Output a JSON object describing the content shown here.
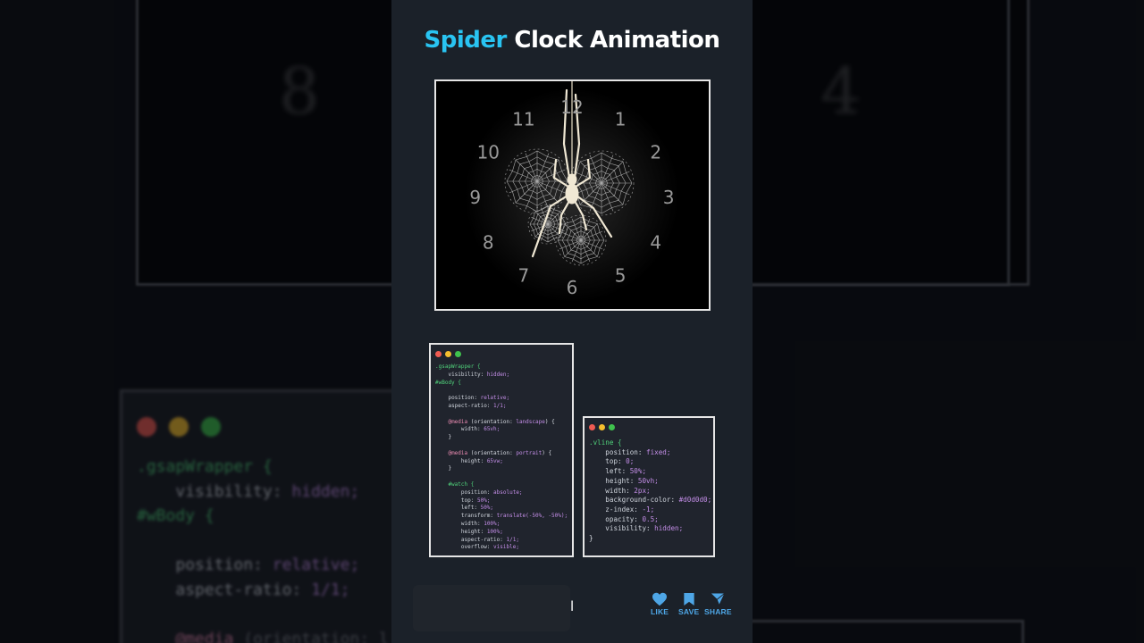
{
  "title": {
    "accent": "Spider",
    "rest": " Clock Animation"
  },
  "clock": {
    "numbers": [
      "12",
      "1",
      "2",
      "3",
      "4",
      "5",
      "6",
      "7",
      "8",
      "9",
      "10",
      "11"
    ]
  },
  "code_snippets": {
    "main": {
      "lines": [
        ".gsapWrapper {",
        "    visibility: hidden;",
        "#wBody {",
        "",
        "    position: relative;",
        "    aspect-ratio: 1/1;",
        "",
        "    @media (orientation: landscape) {",
        "        width: 65vh;",
        "    }",
        "",
        "    @media (orientation: portrait) {",
        "        height: 65vw;",
        "    }",
        "",
        "    #watch {",
        "        position: absolute;",
        "        top: 50%;",
        "        left: 50%;",
        "        transform: translate(-50%, -50%);",
        "        width: 100%;",
        "        height: 100%;",
        "        aspect-ratio: 1/1;",
        "        overflow: visible;"
      ]
    },
    "vline": {
      "lines": [
        ".vline {",
        "    position: fixed;",
        "    top: 0;",
        "    left: 50%;",
        "    height: 50vh;",
        "    width: 2px;",
        "    background-color: #d0d0d0;",
        "    z-index: -1;",
        "    opacity: 0.5;",
        "    visibility: hidden;",
        "}"
      ]
    }
  },
  "background_code": {
    "lines": [
      ".gsapWrapper {",
      "    visibility: hidden;",
      "#wBody {",
      "",
      "    position: relative;",
      "    aspect-ratio: 1/1;",
      "",
      "    @media (orientation: l"
    ]
  },
  "background_digits": [
    "8",
    "4"
  ],
  "caption_tail": "l",
  "actions": {
    "like": "LIKE",
    "save": "SAVE",
    "share": "SHARE"
  },
  "colors": {
    "accent": "#29c4f2",
    "action": "#4ea6e6",
    "panel": "#1b2129",
    "code_bg": "#20242d",
    "selector": "#4fd17a",
    "value": "#c48ee8"
  },
  "icons": [
    "heart-icon",
    "bookmark-icon",
    "send-icon"
  ]
}
